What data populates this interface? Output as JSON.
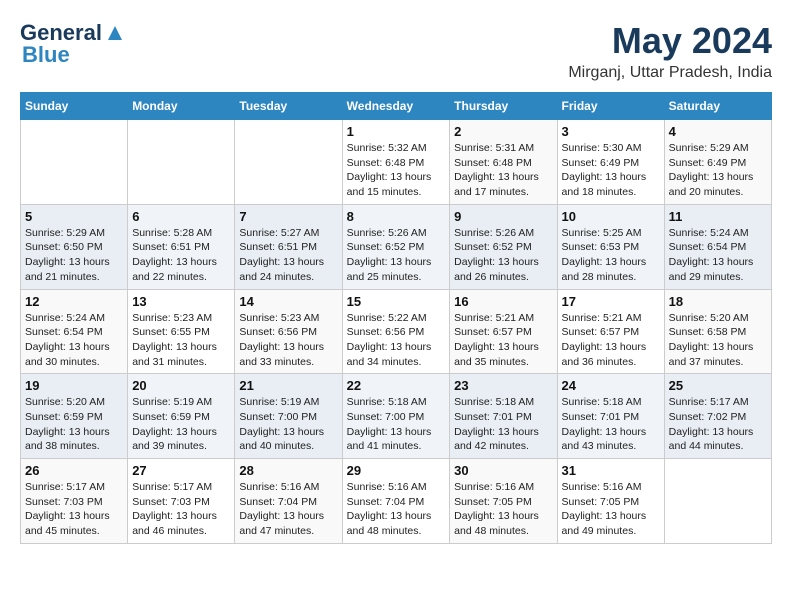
{
  "header": {
    "logo_line1": "General",
    "logo_line2": "Blue",
    "title": "May 2024",
    "location": "Mirganj, Uttar Pradesh, India"
  },
  "weekdays": [
    "Sunday",
    "Monday",
    "Tuesday",
    "Wednesday",
    "Thursday",
    "Friday",
    "Saturday"
  ],
  "weeks": [
    [
      {
        "day": "",
        "info": ""
      },
      {
        "day": "",
        "info": ""
      },
      {
        "day": "",
        "info": ""
      },
      {
        "day": "1",
        "info": "Sunrise: 5:32 AM\nSunset: 6:48 PM\nDaylight: 13 hours\nand 15 minutes."
      },
      {
        "day": "2",
        "info": "Sunrise: 5:31 AM\nSunset: 6:48 PM\nDaylight: 13 hours\nand 17 minutes."
      },
      {
        "day": "3",
        "info": "Sunrise: 5:30 AM\nSunset: 6:49 PM\nDaylight: 13 hours\nand 18 minutes."
      },
      {
        "day": "4",
        "info": "Sunrise: 5:29 AM\nSunset: 6:49 PM\nDaylight: 13 hours\nand 20 minutes."
      }
    ],
    [
      {
        "day": "5",
        "info": "Sunrise: 5:29 AM\nSunset: 6:50 PM\nDaylight: 13 hours\nand 21 minutes."
      },
      {
        "day": "6",
        "info": "Sunrise: 5:28 AM\nSunset: 6:51 PM\nDaylight: 13 hours\nand 22 minutes."
      },
      {
        "day": "7",
        "info": "Sunrise: 5:27 AM\nSunset: 6:51 PM\nDaylight: 13 hours\nand 24 minutes."
      },
      {
        "day": "8",
        "info": "Sunrise: 5:26 AM\nSunset: 6:52 PM\nDaylight: 13 hours\nand 25 minutes."
      },
      {
        "day": "9",
        "info": "Sunrise: 5:26 AM\nSunset: 6:52 PM\nDaylight: 13 hours\nand 26 minutes."
      },
      {
        "day": "10",
        "info": "Sunrise: 5:25 AM\nSunset: 6:53 PM\nDaylight: 13 hours\nand 28 minutes."
      },
      {
        "day": "11",
        "info": "Sunrise: 5:24 AM\nSunset: 6:54 PM\nDaylight: 13 hours\nand 29 minutes."
      }
    ],
    [
      {
        "day": "12",
        "info": "Sunrise: 5:24 AM\nSunset: 6:54 PM\nDaylight: 13 hours\nand 30 minutes."
      },
      {
        "day": "13",
        "info": "Sunrise: 5:23 AM\nSunset: 6:55 PM\nDaylight: 13 hours\nand 31 minutes."
      },
      {
        "day": "14",
        "info": "Sunrise: 5:23 AM\nSunset: 6:56 PM\nDaylight: 13 hours\nand 33 minutes."
      },
      {
        "day": "15",
        "info": "Sunrise: 5:22 AM\nSunset: 6:56 PM\nDaylight: 13 hours\nand 34 minutes."
      },
      {
        "day": "16",
        "info": "Sunrise: 5:21 AM\nSunset: 6:57 PM\nDaylight: 13 hours\nand 35 minutes."
      },
      {
        "day": "17",
        "info": "Sunrise: 5:21 AM\nSunset: 6:57 PM\nDaylight: 13 hours\nand 36 minutes."
      },
      {
        "day": "18",
        "info": "Sunrise: 5:20 AM\nSunset: 6:58 PM\nDaylight: 13 hours\nand 37 minutes."
      }
    ],
    [
      {
        "day": "19",
        "info": "Sunrise: 5:20 AM\nSunset: 6:59 PM\nDaylight: 13 hours\nand 38 minutes."
      },
      {
        "day": "20",
        "info": "Sunrise: 5:19 AM\nSunset: 6:59 PM\nDaylight: 13 hours\nand 39 minutes."
      },
      {
        "day": "21",
        "info": "Sunrise: 5:19 AM\nSunset: 7:00 PM\nDaylight: 13 hours\nand 40 minutes."
      },
      {
        "day": "22",
        "info": "Sunrise: 5:18 AM\nSunset: 7:00 PM\nDaylight: 13 hours\nand 41 minutes."
      },
      {
        "day": "23",
        "info": "Sunrise: 5:18 AM\nSunset: 7:01 PM\nDaylight: 13 hours\nand 42 minutes."
      },
      {
        "day": "24",
        "info": "Sunrise: 5:18 AM\nSunset: 7:01 PM\nDaylight: 13 hours\nand 43 minutes."
      },
      {
        "day": "25",
        "info": "Sunrise: 5:17 AM\nSunset: 7:02 PM\nDaylight: 13 hours\nand 44 minutes."
      }
    ],
    [
      {
        "day": "26",
        "info": "Sunrise: 5:17 AM\nSunset: 7:03 PM\nDaylight: 13 hours\nand 45 minutes."
      },
      {
        "day": "27",
        "info": "Sunrise: 5:17 AM\nSunset: 7:03 PM\nDaylight: 13 hours\nand 46 minutes."
      },
      {
        "day": "28",
        "info": "Sunrise: 5:16 AM\nSunset: 7:04 PM\nDaylight: 13 hours\nand 47 minutes."
      },
      {
        "day": "29",
        "info": "Sunrise: 5:16 AM\nSunset: 7:04 PM\nDaylight: 13 hours\nand 48 minutes."
      },
      {
        "day": "30",
        "info": "Sunrise: 5:16 AM\nSunset: 7:05 PM\nDaylight: 13 hours\nand 48 minutes."
      },
      {
        "day": "31",
        "info": "Sunrise: 5:16 AM\nSunset: 7:05 PM\nDaylight: 13 hours\nand 49 minutes."
      },
      {
        "day": "",
        "info": ""
      }
    ]
  ]
}
